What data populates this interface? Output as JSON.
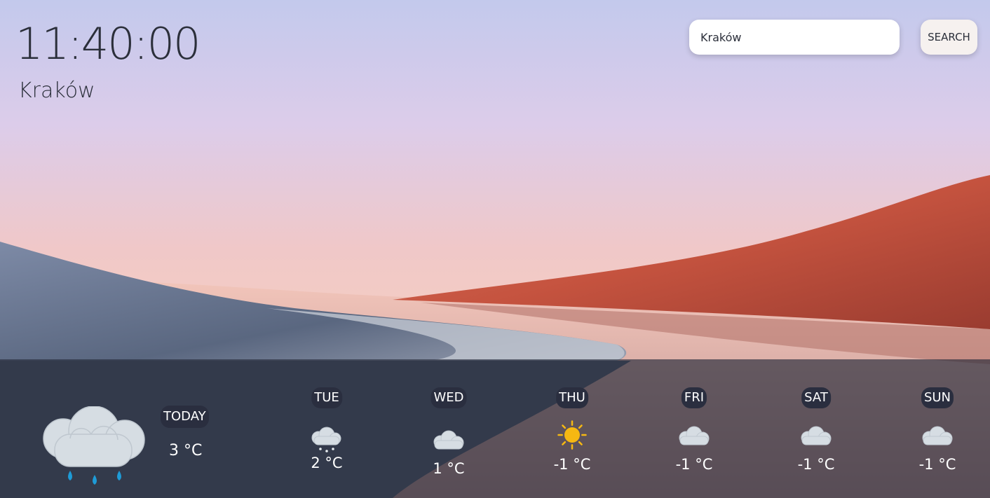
{
  "clock": {
    "time": "11:40:00"
  },
  "location": {
    "city": "Kraków"
  },
  "search": {
    "value": "Kraków",
    "button_label": "SEARCH"
  },
  "today": {
    "label": "TODAY",
    "temp": "3 °C",
    "icon": "rain-cloud-icon"
  },
  "forecast": [
    {
      "day": "TUE",
      "temp": "2 °C",
      "icon": "snow-cloud-icon"
    },
    {
      "day": "WED",
      "temp": "1 °C",
      "icon": "cloud-icon"
    },
    {
      "day": "THU",
      "temp": "-1 °C",
      "icon": "sun-icon"
    },
    {
      "day": "FRI",
      "temp": "-1 °C",
      "icon": "cloud-icon"
    },
    {
      "day": "SAT",
      "temp": "-1 °C",
      "icon": "cloud-icon"
    },
    {
      "day": "SUN",
      "temp": "-1 °C",
      "icon": "cloud-icon"
    }
  ],
  "colors": {
    "panel": "#262a3a",
    "label_bg": "#2a2e3f",
    "text_dark": "#2b2f3a",
    "text_light": "#ffffff",
    "sun": "#f6b812",
    "rain": "#1e9bd7"
  }
}
